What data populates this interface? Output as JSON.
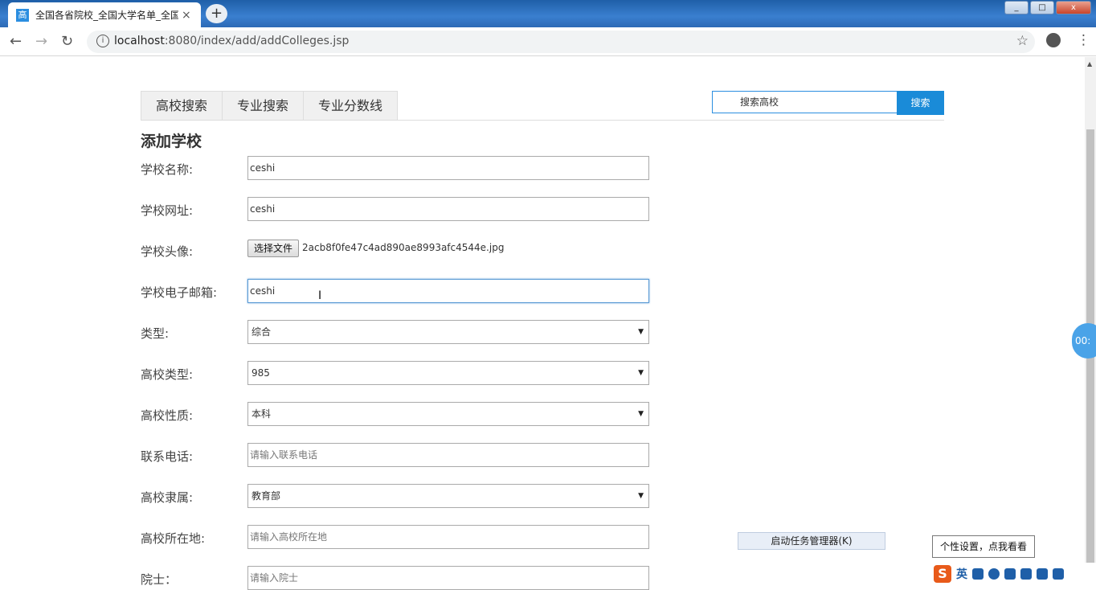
{
  "browser": {
    "tab_favicon": "高",
    "tab_title": "全国各省院校_全国大学名单_全国",
    "tab_close": "×",
    "new_tab": "+",
    "url_host": "localhost",
    "url_path": ":8080/index/add/addColleges.jsp",
    "back": "←",
    "forward": "→",
    "reload": "↻",
    "star": "☆",
    "menu": "⋮"
  },
  "nav": {
    "tabs": [
      "高校搜索",
      "专业搜索",
      "专业分数线"
    ],
    "search_placeholder": "搜索高校",
    "search_button": "搜索"
  },
  "form": {
    "title": "添加学校",
    "name_label": "学校名称:",
    "name_value": "ceshi",
    "url_label": "学校网址:",
    "url_value": "ceshi",
    "avatar_label": "学校头像:",
    "file_button": "选择文件",
    "file_name": "2acb8f0fe47c4ad890ae8993afc4544e.jpg",
    "email_label": "学校电子邮箱:",
    "email_value": "ceshi",
    "type_label": "类型:",
    "type_value": "综合",
    "level_label": "高校类型:",
    "level_value": "985",
    "nature_label": "高校性质:",
    "nature_value": "本科",
    "phone_label": "联系电话:",
    "phone_placeholder": "请输入联系电话",
    "affil_label": "高校隶属:",
    "affil_value": "教育部",
    "location_label": "高校所在地:",
    "location_placeholder": "请输入高校所在地",
    "academician_label": "院士：",
    "academician_placeholder": "请输入院士"
  },
  "overlay": {
    "task_manager": "启动任务管理器(K)",
    "tooltip": "个性设置，点我看看",
    "ime_logo": "S",
    "ime_lang": "英",
    "timer": "00:"
  },
  "icons": {
    "caret": "▼",
    "cursor": "I"
  }
}
